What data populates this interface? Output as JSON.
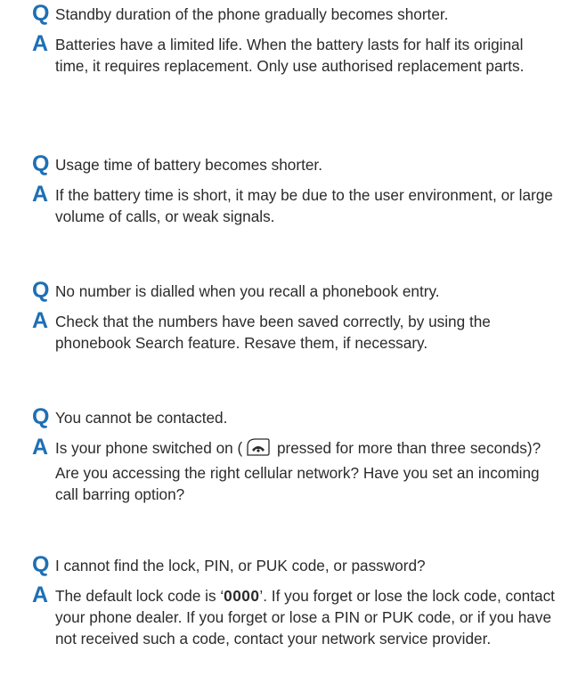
{
  "colors": {
    "q_marker": "#1e6fb5",
    "a_marker": "#1e6fb5",
    "text": "#2b2b2b"
  },
  "markers": {
    "q": "Q",
    "a": "A"
  },
  "items": [
    {
      "question": "Standby duration of the phone gradually becomes shorter.",
      "answer": "Batteries have a limited life. When the battery lasts for half its original time, it requires replacement. Only use authorised replacement parts."
    },
    {
      "question": "Usage time of battery becomes shorter.",
      "answer": "If the battery time is short, it may be due to the user environment, or large volume of calls, or weak signals."
    },
    {
      "question": "No number is dialled when you recall a phonebook entry.",
      "answer": "Check that the numbers have been saved correctly, by using the phonebook Search feature. Resave them, if necessary."
    },
    {
      "question": "You cannot be contacted.",
      "answer_before_icon": "Is your phone switched on (",
      "answer_icon": "end-key-icon",
      "answer_after_icon": " pressed for more than three seconds)? Are you accessing the right cellular network? Have you set an incoming call barring option?"
    },
    {
      "question": "I cannot find the lock, PIN, or PUK code, or password?",
      "answer_before_code": "The default lock code is ‘",
      "lock_code": "0000",
      "answer_after_code": "’. If you forget or lose the lock code, contact your phone dealer. If you forget or lose a PIN or PUK code, or if you have not received such a code, contact your network service provider."
    }
  ]
}
